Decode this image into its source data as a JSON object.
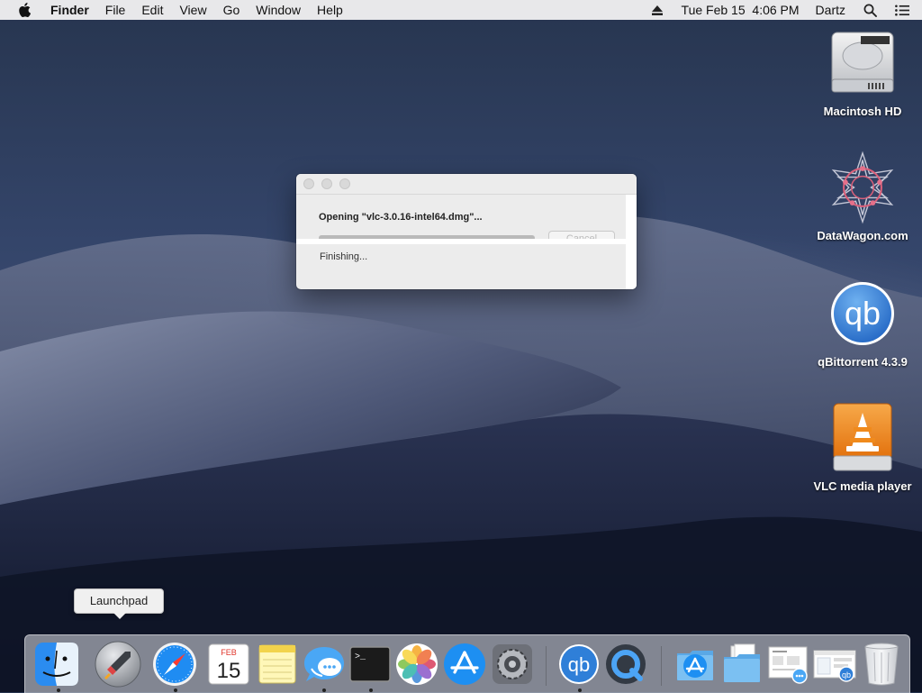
{
  "menubar": {
    "apple_icon": "apple-icon",
    "app_name": "Finder",
    "menus": [
      "File",
      "Edit",
      "View",
      "Go",
      "Window",
      "Help"
    ],
    "eject_icon": "eject-icon",
    "datetime": "Tue Feb 15  4:06 PM",
    "user": "Dartz",
    "search_icon": "spotlight-search-icon",
    "control_icon": "notification-center-icon"
  },
  "desktop_icons": [
    {
      "label": "Macintosh HD",
      "icon": "hard-drive-icon"
    },
    {
      "label": "DataWagon.com",
      "icon": "datawagon-icon"
    },
    {
      "label": "qBittorrent 4.3.9",
      "icon": "qbittorrent-icon"
    },
    {
      "label": "VLC media player",
      "icon": "vlc-disk-icon"
    }
  ],
  "dialog": {
    "opening_text": "Opening \"vlc-3.0.16-intel64.dmg\"...",
    "cancel_label": "Cancel",
    "status_text": "Finishing...",
    "progress": 1.0
  },
  "tooltip": {
    "text": "Launchpad"
  },
  "dock": {
    "items": [
      {
        "name": "Finder",
        "icon": "finder-icon",
        "running": true
      },
      {
        "name": "Launchpad",
        "icon": "launchpad-icon",
        "running": false
      },
      {
        "name": "Safari",
        "icon": "safari-icon",
        "running": true
      },
      {
        "name": "Calendar",
        "icon": "calendar-icon",
        "running": false,
        "month": "FEB",
        "day": "15"
      },
      {
        "name": "Notes",
        "icon": "notes-icon",
        "running": false
      },
      {
        "name": "Messages",
        "icon": "messages-icon",
        "running": true
      },
      {
        "name": "Terminal",
        "icon": "terminal-icon",
        "running": true
      },
      {
        "name": "Photos",
        "icon": "photos-icon",
        "running": false
      },
      {
        "name": "App Store",
        "icon": "app-store-icon",
        "running": false
      },
      {
        "name": "System Preferences",
        "icon": "system-preferences-icon",
        "running": false
      },
      {
        "name": "qBittorrent",
        "icon": "qbittorrent-icon",
        "running": true
      },
      {
        "name": "QuickTime Player",
        "icon": "quicktime-icon",
        "running": false
      },
      {
        "name": "Applications",
        "icon": "applications-folder-icon",
        "running": false
      },
      {
        "name": "Documents",
        "icon": "documents-folder-icon",
        "running": false
      },
      {
        "name": "Downloads",
        "icon": "downloads-stack-icon",
        "running": false
      },
      {
        "name": "Screenshots",
        "icon": "screenshots-stack-icon",
        "running": false
      },
      {
        "name": "Trash",
        "icon": "trash-icon",
        "running": false
      }
    ],
    "terminal_prompt": ">_"
  },
  "colors": {
    "menubar_bg": "#eeeef0",
    "dock_bg": "#e1e4eb",
    "dialog_bg": "#ececec",
    "qb_blue": "#2f7fd8",
    "vlc_orange": "#f08a1c"
  }
}
